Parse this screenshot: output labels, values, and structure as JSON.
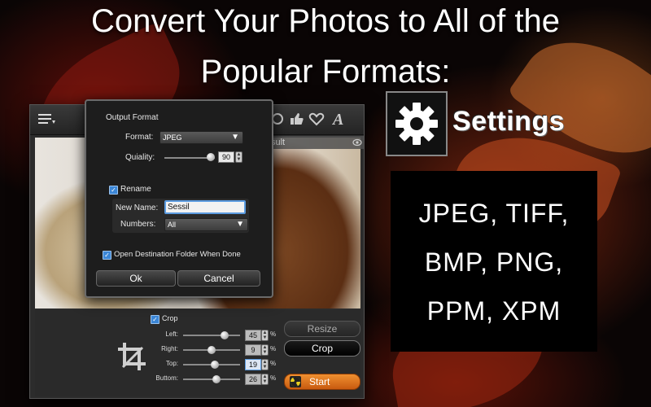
{
  "headline": {
    "line1": "Convert Your Photos to All of the",
    "line2": "Popular Formats:"
  },
  "app": {
    "result_label": "sult",
    "toolbar_icons": [
      "list-icon",
      "thumbs-up-icon",
      "heart-icon",
      "text-style-icon"
    ]
  },
  "dialog": {
    "section_title": "Output Format",
    "format_label": "Format:",
    "format_value": "JPEG",
    "quality_label": "Quiality:",
    "quality_value": "90",
    "quality_level": 0.9,
    "rename_label": "Rename",
    "rename_checked": true,
    "new_name_label": "New Name:",
    "new_name_value": "Sessil",
    "numbers_label": "Numbers:",
    "numbers_value": "All",
    "open_folder_label": "Open Destination Folder When Done",
    "open_folder_checked": true,
    "ok_label": "Ok",
    "cancel_label": "Cancel"
  },
  "crop_panel": {
    "crop_label": "Crop",
    "crop_checked": true,
    "rows": [
      {
        "label": "Left:",
        "value": "45",
        "unit": "%"
      },
      {
        "label": "Right:",
        "value": "9",
        "unit": "%"
      },
      {
        "label": "Top:",
        "value": "19",
        "unit": "%"
      },
      {
        "label": "Buttom:",
        "value": "26",
        "unit": "%"
      }
    ],
    "resize_label": "Resize",
    "crop_button_label": "Crop",
    "start_label": "Start"
  },
  "settings": {
    "label": "Settings",
    "icon": "gear-icon"
  },
  "formats": {
    "line1": "JPEG, TIFF,",
    "line2": "BMP, PNG,",
    "line3": "PPM, XPM"
  },
  "colors": {
    "accent_blue": "#3b86d6",
    "start_orange": "#e0781a"
  }
}
